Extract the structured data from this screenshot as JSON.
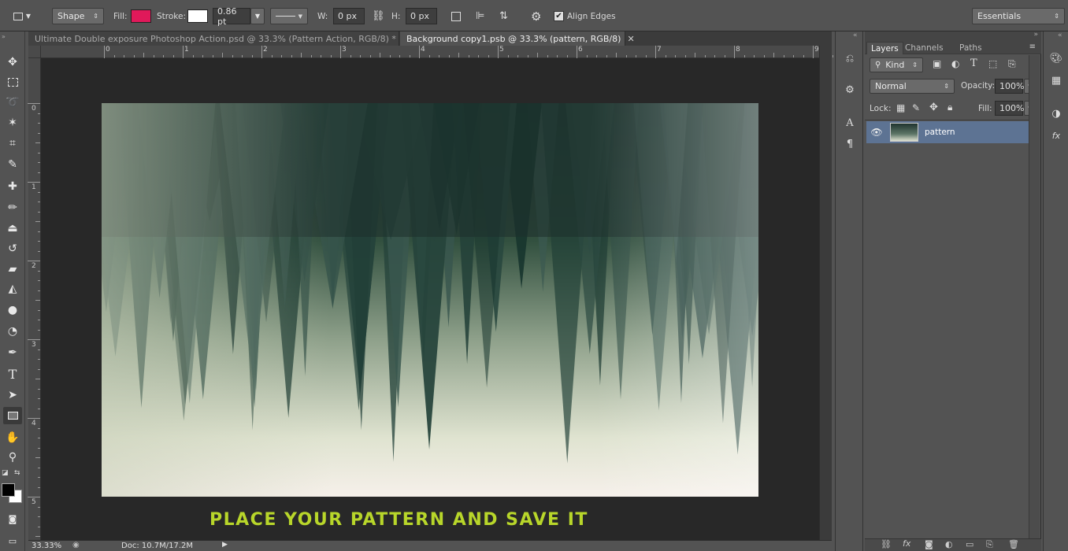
{
  "options_bar": {
    "mode": "Shape",
    "fill_label": "Fill:",
    "fill_color": "#e0195a",
    "stroke_label": "Stroke:",
    "stroke_color": "#ffffff",
    "stroke_width": "0.86 pt",
    "w_label": "W:",
    "w_value": "0 px",
    "h_label": "H:",
    "h_value": "0 px",
    "align_edges": "Align Edges",
    "workspace": "Essentials"
  },
  "tabs": [
    {
      "label": "Ultimate Double exposure Photoshop Action.psd @ 33.3% (Pattern Action, RGB/8) *"
    },
    {
      "label": "Background copy1.psb @ 33.3% (pattern, RGB/8)"
    }
  ],
  "ruler": {
    "top": [
      "0",
      "1",
      "2",
      "3",
      "4",
      "5",
      "6",
      "7",
      "8",
      "9"
    ],
    "left": [
      "0",
      "1",
      "2",
      "3",
      "4",
      "5"
    ]
  },
  "canvas": {
    "caption": "PLACE YOUR PATTERN AND SAVE IT",
    "caption_color": "#b8d62a"
  },
  "status": {
    "zoom": "33.33%",
    "doc": "Doc: 10.7M/17.2M"
  },
  "layers_panel": {
    "tabs": [
      "Layers",
      "Channels",
      "Paths"
    ],
    "kind": "Kind",
    "blend_mode": "Normal",
    "opacity_label": "Opacity:",
    "opacity_value": "100%",
    "lock_label": "Lock:",
    "fill_label": "Fill:",
    "fill_value": "100%",
    "layers": [
      {
        "name": "pattern",
        "selected": true
      }
    ]
  },
  "toolbar_icons": [
    "move-icon",
    "marquee-icon",
    "lasso-icon",
    "magic-wand-icon",
    "crop-icon",
    "eyedropper-icon",
    "healing-brush-icon",
    "brush-icon",
    "clone-stamp-icon",
    "history-brush-icon",
    "eraser-icon",
    "paint-bucket-icon",
    "blur-icon",
    "dodge-icon",
    "pen-icon",
    "type-icon",
    "path-selection-icon",
    "rectangle-icon",
    "hand-icon",
    "zoom-icon"
  ]
}
